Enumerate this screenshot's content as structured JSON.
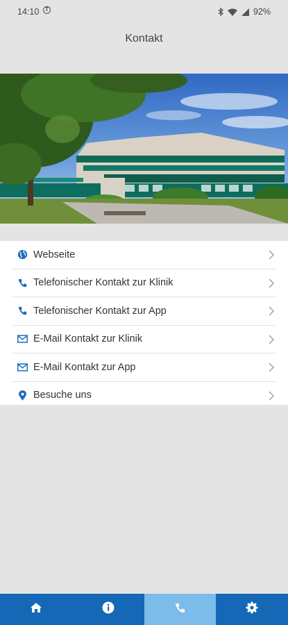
{
  "status_bar": {
    "time": "14:10",
    "app_icon": "circle-t-icon",
    "battery": "92%",
    "icons": [
      "bluetooth-icon",
      "wifi-icon",
      "signal-icon"
    ]
  },
  "header": {
    "title": "Kontakt"
  },
  "hero": {
    "image": "clinic-building-photo"
  },
  "contact_list": {
    "items": [
      {
        "label": "Webseite",
        "icon": "globe-icon"
      },
      {
        "label": "Telefonischer Kontakt zur Klinik",
        "icon": "phone-icon"
      },
      {
        "label": "Telefonischer Kontakt zur App",
        "icon": "phone-icon"
      },
      {
        "label": "E-Mail Kontakt zur Klinik",
        "icon": "envelope-icon"
      },
      {
        "label": "E-Mail Kontakt zur App",
        "icon": "envelope-icon"
      },
      {
        "label": "Besuche uns",
        "icon": "map-marker-icon"
      }
    ]
  },
  "bottom_nav": {
    "tabs": [
      {
        "icon": "home-icon",
        "active": false
      },
      {
        "icon": "info-icon",
        "active": false
      },
      {
        "icon": "phone-icon",
        "active": true
      },
      {
        "icon": "gear-icon",
        "active": false
      }
    ]
  },
  "colors": {
    "accent": "#1468b5",
    "accent_light": "#7dbbeb",
    "background": "#e4e4e4",
    "icon": "#1a6bbd"
  }
}
